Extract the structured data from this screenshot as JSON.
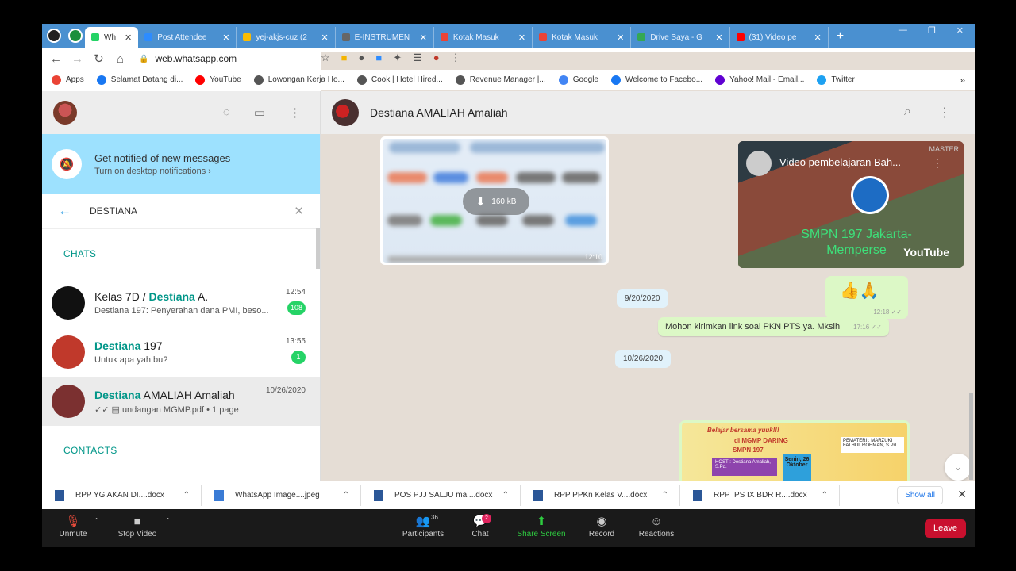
{
  "browser": {
    "tabs": [
      {
        "title": "Wh",
        "favicon_color": "#25d366"
      },
      {
        "title": "Post Attendee",
        "favicon_color": "#2d8cff"
      },
      {
        "title": "yej-akjs-cuz (2",
        "favicon_color": "#fbbc04"
      },
      {
        "title": "E-INSTRUMEN",
        "favicon_color": "#666666"
      },
      {
        "title": "Kotak Masuk",
        "favicon_color": "#ea4335"
      },
      {
        "title": "Kotak Masuk",
        "favicon_color": "#ea4335"
      },
      {
        "title": "Drive Saya - G",
        "favicon_color": "#34a853"
      },
      {
        "title": "(31) Video pe",
        "favicon_color": "#ff0000"
      }
    ],
    "url": "web.whatsapp.com",
    "bookmarks": [
      {
        "label": "Apps",
        "color": "#ea4335"
      },
      {
        "label": "Selamat Datang di...",
        "color": "#1877f2"
      },
      {
        "label": "YouTube",
        "color": "#ff0000"
      },
      {
        "label": "Lowongan Kerja Ho...",
        "color": "#555555"
      },
      {
        "label": "Cook | Hotel Hired...",
        "color": "#555555"
      },
      {
        "label": "Revenue Manager |...",
        "color": "#555555"
      },
      {
        "label": "Google",
        "color": "#4285f4"
      },
      {
        "label": "Welcome to Facebo...",
        "color": "#1877f2"
      },
      {
        "label": "Yahoo! Mail - Email...",
        "color": "#6001d2"
      },
      {
        "label": "Twitter",
        "color": "#1da1f2"
      }
    ]
  },
  "notification": {
    "title": "Get notified of new messages",
    "subtitle": "Turn on desktop notifications ›"
  },
  "search": {
    "value": "DESTIANA"
  },
  "sections": {
    "chats": "CHATS",
    "contacts": "CONTACTS"
  },
  "chats": [
    {
      "name_pre": "Kelas 7D / ",
      "name_hl": "Destiana",
      "name_post": " A.",
      "message": "Destiana 197: Penyerahan dana PMI, beso...",
      "time": "12:54",
      "badge": "108",
      "avatar_color": "#111111"
    },
    {
      "name_pre": "",
      "name_hl": "Destiana",
      "name_post": " 197",
      "message": "Untuk apa yah bu?",
      "time": "13:55",
      "badge": "1",
      "avatar_color": "#c0392b"
    },
    {
      "name_pre": "",
      "name_hl": "Destiana",
      "name_post": " AMALIAH Amaliah",
      "message": "✓✓ ▤ undangan MGMP.pdf • 1 page",
      "time": "10/26/2020",
      "badge": "",
      "avatar_color": "#7b3030"
    }
  ],
  "conversation": {
    "contact": "Destiana AMALIAH Amaliah",
    "image_size": "160 kB",
    "image_time": "12:10",
    "video_title": "Video pembelajaran Bah...",
    "video_caption": "SMPN 197 Jakarta-Memperse",
    "video_brand": "YouTube",
    "video_mark": "MASTER",
    "emoji_message": "👍🙏",
    "emoji_time": "12:18 ✓✓",
    "date1": "9/20/2020",
    "text_message": "Mohon kirimkan link soal PKN PTS ya. Mksih",
    "text_time": "17:16 ✓✓",
    "date2": "10/26/2020",
    "poster": {
      "line1": "Belajar bersama yuuk!!!",
      "line2": "di MGMP DARING",
      "line3": "SMPN 197",
      "host": "HOST : Destiana Amaliah, S.Pd.",
      "date": "Senin, 26 Oktober",
      "pemateri": "PEMATERI : MARZUKI FATHUL ROHMAN, S.Pd"
    }
  },
  "downloads": [
    "RPP  YG AKAN DI....docx",
    "WhatsApp Image....jpeg",
    "POS PJJ SALJU ma....docx",
    "RPP PPKn Kelas V....docx",
    "RPP IPS IX BDR R....docx"
  ],
  "downloads_show_all": "Show all",
  "zoom": {
    "unmute": "Unmute",
    "stop_video": "Stop Video",
    "participants": "Participants",
    "participants_count": "36",
    "chat": "Chat",
    "chat_badge": "2",
    "share": "Share Screen",
    "record": "Record",
    "reactions": "Reactions",
    "leave": "Leave"
  }
}
